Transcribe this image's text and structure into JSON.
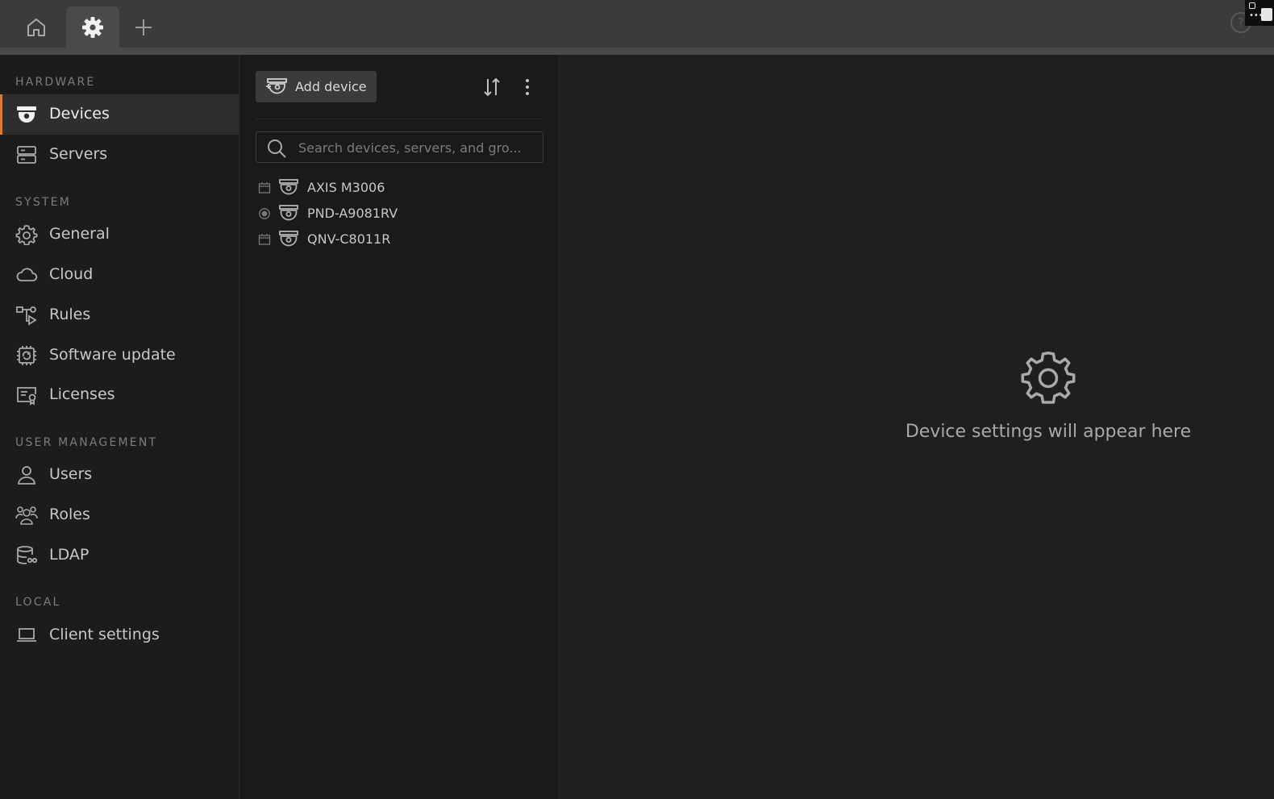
{
  "tabs": [
    {
      "name": "home",
      "icon": "home-icon"
    },
    {
      "name": "settings",
      "icon": "gear-icon",
      "active": true
    },
    {
      "name": "add",
      "icon": "plus-icon"
    }
  ],
  "topbar": {
    "help_icon": "help-icon",
    "help_label": "?"
  },
  "sidebar": {
    "sections": [
      {
        "title": "HARDWARE"
      },
      {
        "title": "SYSTEM"
      },
      {
        "title": "USER MANAGEMENT"
      },
      {
        "title": "LOCAL"
      }
    ],
    "items": [
      {
        "label": "Devices",
        "icon": "camera-dome-icon",
        "active": true
      },
      {
        "label": "Servers",
        "icon": "server-icon"
      },
      {
        "label": "General",
        "icon": "gear-icon"
      },
      {
        "label": "Cloud",
        "icon": "cloud-icon"
      },
      {
        "label": "Rules",
        "icon": "rules-icon"
      },
      {
        "label": "Software update",
        "icon": "software-update-icon"
      },
      {
        "label": "Licenses",
        "icon": "license-icon"
      },
      {
        "label": "Users",
        "icon": "user-icon"
      },
      {
        "label": "Roles",
        "icon": "roles-icon"
      },
      {
        "label": "LDAP",
        "icon": "ldap-icon"
      },
      {
        "label": "Client settings",
        "icon": "laptop-icon"
      }
    ]
  },
  "device_list": {
    "add_button_label": "Add device",
    "search_placeholder": "Search devices, servers, and gro...",
    "devices": [
      {
        "name": "AXIS M3006",
        "status_icon": "calendar-icon"
      },
      {
        "name": "PND-A9081RV",
        "status_icon": "recording-icon"
      },
      {
        "name": "QNV-C8011R",
        "status_icon": "calendar-icon"
      }
    ]
  },
  "content": {
    "placeholder_text": "Device settings will appear here",
    "placeholder_icon": "gear-icon"
  },
  "colors": {
    "accent": "#e8762b",
    "tabbar_bg": "#3b3b3b",
    "sidebar_bg": "#1c1c1c",
    "content_bg": "#1f1f1f"
  }
}
